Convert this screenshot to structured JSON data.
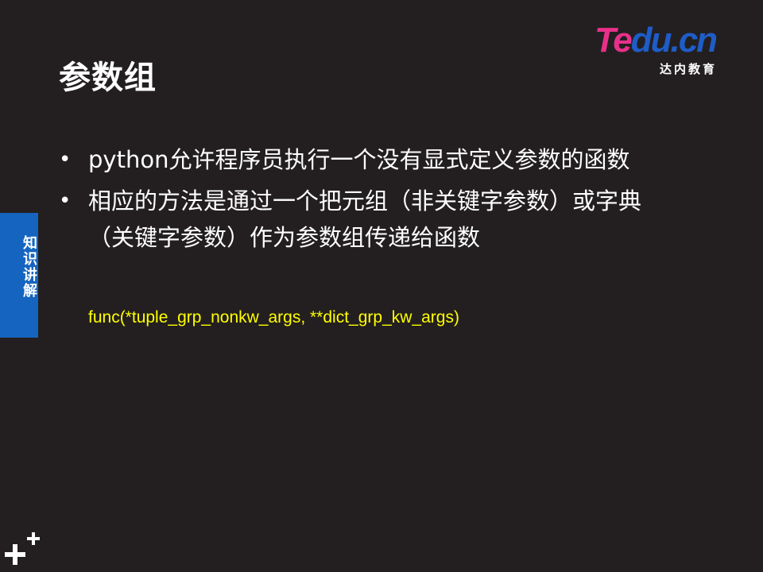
{
  "slide": {
    "title": "参数组",
    "logo": {
      "word_part1": "Te",
      "word_part2": "du.cn",
      "subtitle": "达内教育"
    },
    "side_tab": {
      "label": "知识讲解"
    },
    "bullets": [
      {
        "text": "python允许程序员执行一个没有显式定义参数的函数"
      },
      {
        "text": "相应的方法是通过一个把元组（非关键字参数）或字典（关键字参数）作为参数组传递给函数"
      }
    ],
    "code_example": "func(*tuple_grp_nonkw_args, **dict_grp_kw_args)",
    "colors": {
      "background": "#231f20",
      "tab": "#1565c0",
      "code": "#ffff00",
      "logo_pink": "#e8308a",
      "logo_blue": "#1e5cc8"
    },
    "icons": {
      "corner": "plus-icon",
      "bullet": "bullet-dot-icon"
    }
  }
}
